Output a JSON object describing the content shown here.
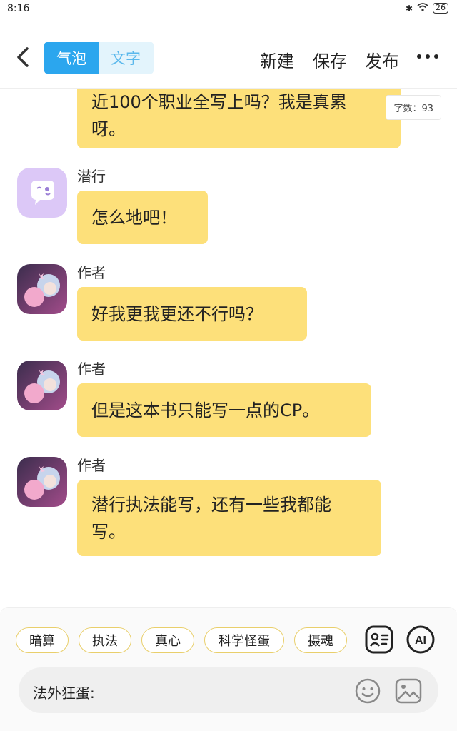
{
  "status_bar": {
    "time": "8:16",
    "battery": "26"
  },
  "header": {
    "mode_bubble": "气泡",
    "mode_text": "文字",
    "new_label": "新建",
    "save_label": "保存",
    "publish_label": "发布"
  },
  "chat": {
    "word_count": "字数：93",
    "messages": [
      {
        "sender": "",
        "text_line1": "近100个职业全写上吗？我是真累",
        "text_line2": "呀。"
      },
      {
        "sender": "潜行",
        "avatar": "chat-bubble-avatar",
        "text": "怎么地吧！"
      },
      {
        "sender": "作者",
        "avatar": "anime-character-avatar",
        "text": "好我更我更还不行吗？"
      },
      {
        "sender": "作者",
        "avatar": "anime-character-avatar",
        "text": "但是这本书只能写一点的CP。"
      },
      {
        "sender": "作者",
        "avatar": "anime-character-avatar",
        "text_line1": "潜行执法能写，还有一些我都能",
        "text_line2": "写。"
      }
    ]
  },
  "tags": [
    "暗算",
    "执法",
    "真心",
    "科学怪蛋",
    "摄魂"
  ],
  "input": {
    "value": "法外狂蛋:"
  },
  "colors": {
    "accent": "#2ba6ee",
    "bubble": "#fde07a",
    "tag_border": "#e9cf6b"
  }
}
